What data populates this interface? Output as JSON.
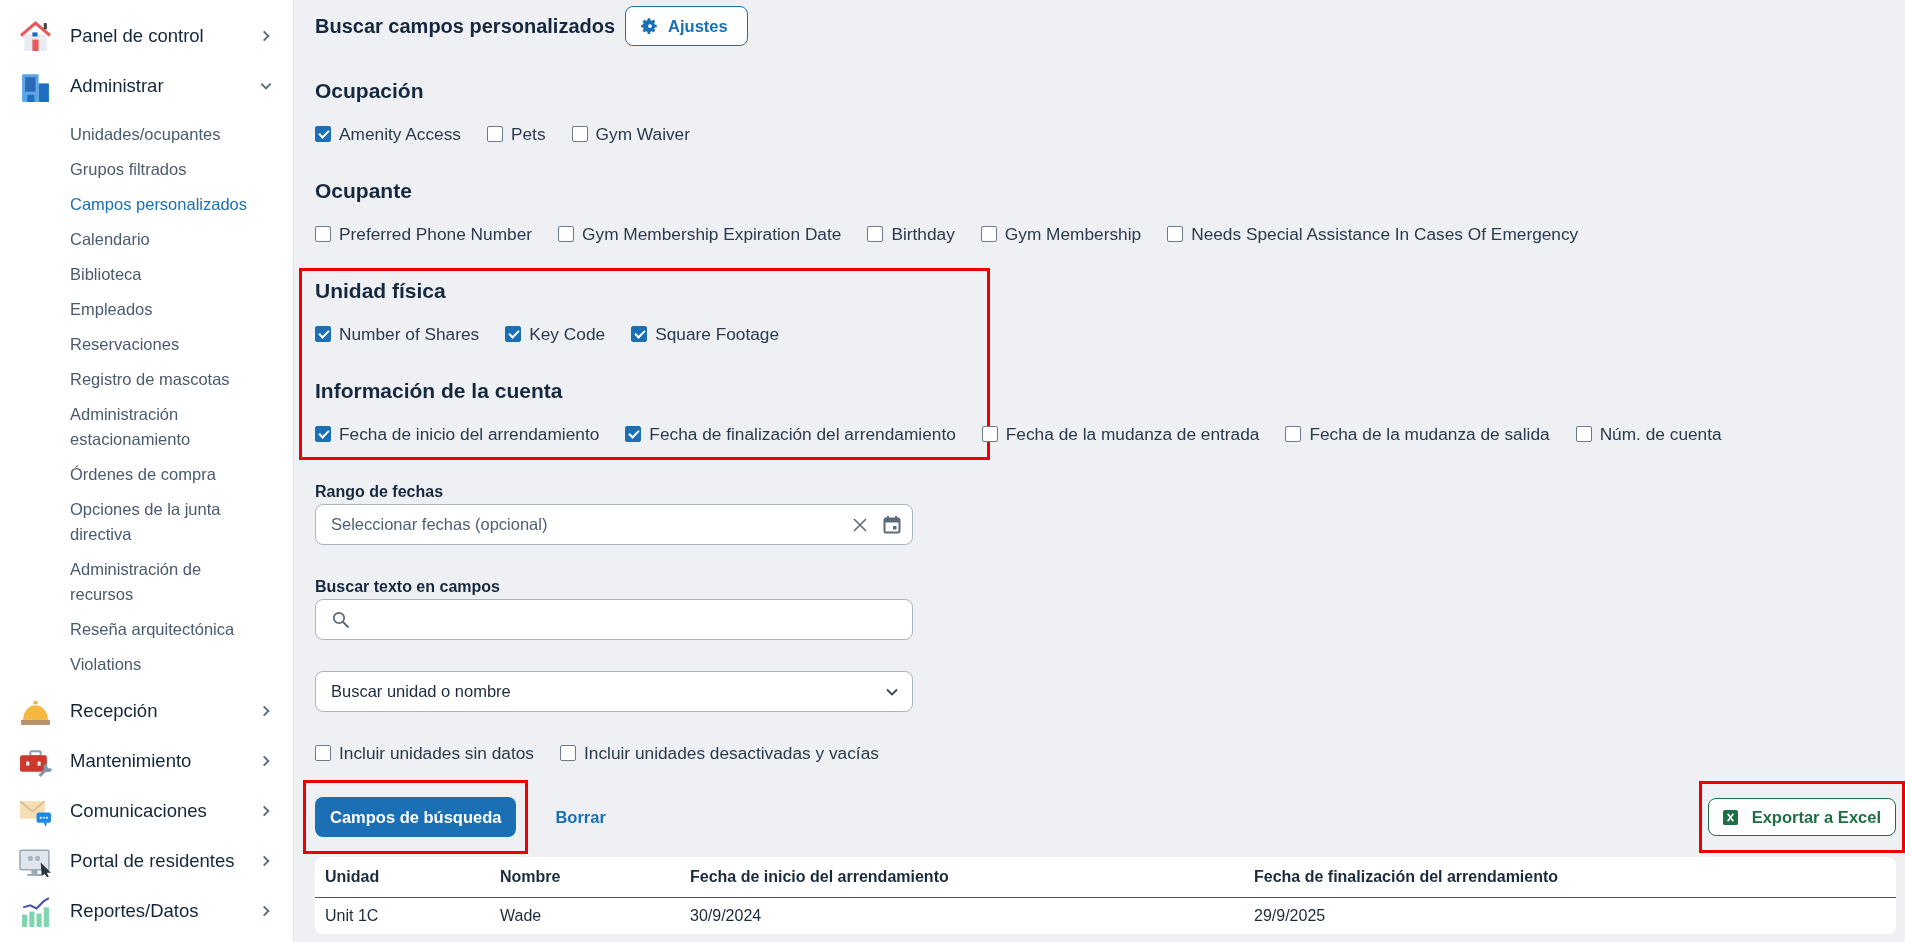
{
  "sidebar": {
    "items": [
      {
        "label": "Panel de control",
        "expanded": false
      },
      {
        "label": "Administrar",
        "expanded": true,
        "children": [
          {
            "label": "Unidades/ocupantes",
            "selected": false
          },
          {
            "label": "Grupos filtrados",
            "selected": false
          },
          {
            "label": "Campos personalizados",
            "selected": true
          },
          {
            "label": "Calendario",
            "selected": false
          },
          {
            "label": "Biblioteca",
            "selected": false
          },
          {
            "label": "Empleados",
            "selected": false
          },
          {
            "label": "Reservaciones",
            "selected": false
          },
          {
            "label": "Registro de mascotas",
            "selected": false
          },
          {
            "label": "Administración estacionamiento",
            "selected": false
          },
          {
            "label": "Órdenes de compra",
            "selected": false
          },
          {
            "label": "Opciones de la junta directiva",
            "selected": false
          },
          {
            "label": "Administración de recursos",
            "selected": false
          },
          {
            "label": "Reseña arquitectónica",
            "selected": false
          },
          {
            "label": "Violations",
            "selected": false
          }
        ]
      },
      {
        "label": "Recepción",
        "expanded": false
      },
      {
        "label": "Mantenimiento",
        "expanded": false
      },
      {
        "label": "Comunicaciones",
        "expanded": false
      },
      {
        "label": "Portal de residentes",
        "expanded": false
      },
      {
        "label": "Reportes/Datos",
        "expanded": false
      }
    ]
  },
  "title": "Buscar campos personalizados",
  "settings_button": "Ajustes",
  "sections": [
    {
      "title": "Ocupación",
      "items": [
        {
          "label": "Amenity Access",
          "checked": true
        },
        {
          "label": "Pets",
          "checked": false
        },
        {
          "label": "Gym Waiver",
          "checked": false
        }
      ]
    },
    {
      "title": "Ocupante",
      "items": [
        {
          "label": "Preferred Phone Number",
          "checked": false
        },
        {
          "label": "Gym Membership Expiration Date",
          "checked": false
        },
        {
          "label": "Birthday",
          "checked": false
        },
        {
          "label": "Gym Membership",
          "checked": false
        },
        {
          "label": "Needs Special Assistance In Cases Of Emergency",
          "checked": false
        }
      ]
    },
    {
      "title": "Unidad física",
      "highlighted": true,
      "items": [
        {
          "label": "Number of Shares",
          "checked": true
        },
        {
          "label": "Key Code",
          "checked": true
        },
        {
          "label": "Square Footage",
          "checked": true
        }
      ]
    },
    {
      "title": "Información de la cuenta",
      "items": [
        {
          "label": "Fecha de inicio del arrendamiento",
          "checked": true
        },
        {
          "label": "Fecha de finalización del arrendamiento",
          "checked": true
        },
        {
          "label": "Fecha de la mudanza de entrada",
          "checked": false
        },
        {
          "label": "Fecha de la mudanza de salida",
          "checked": false
        },
        {
          "label": "Núm. de cuenta",
          "checked": false
        }
      ]
    }
  ],
  "date_range": {
    "label": "Rango de fechas",
    "placeholder": "Seleccionar fechas (opcional)"
  },
  "text_search": {
    "label": "Buscar texto en campos"
  },
  "unit_select": {
    "value": "Buscar unidad o nombre"
  },
  "options": [
    {
      "label": "Incluir unidades sin datos",
      "checked": false
    },
    {
      "label": "Incluir unidades desactivadas y vacías",
      "checked": false
    }
  ],
  "search_button": {
    "label": "Campos de búsqueda",
    "highlighted": true
  },
  "clear_link": "Borrar",
  "export_button": {
    "label": "Exportar a Excel",
    "highlighted": true
  },
  "table": {
    "columns": [
      "Unidad",
      "Nombre",
      "Fecha de inicio del arrendamiento",
      "Fecha de finalización del arrendamiento"
    ],
    "rows": [
      [
        "Unit 1C",
        "Wade",
        "30/9/2024",
        "29/9/2025"
      ]
    ]
  }
}
